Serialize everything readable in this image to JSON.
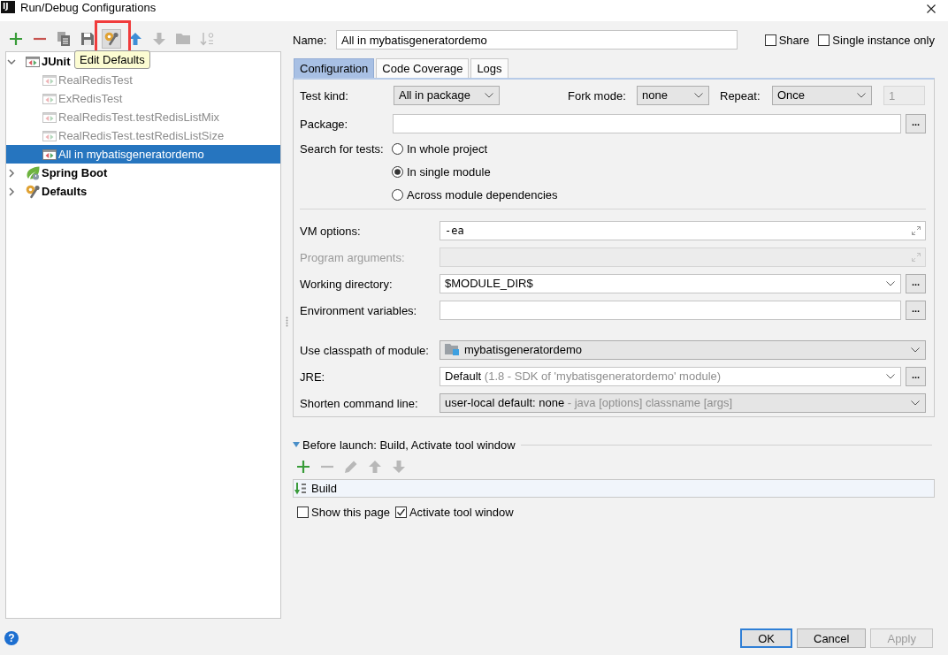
{
  "window": {
    "logo": "IJ",
    "title": "Run/Debug Configurations"
  },
  "toolbar": [
    {
      "kind": "add",
      "disabled": false,
      "hovered": false,
      "highlighted": false
    },
    {
      "kind": "remove",
      "disabled": false,
      "hovered": false,
      "highlighted": false
    },
    {
      "kind": "copy",
      "disabled": false,
      "hovered": false,
      "highlighted": false
    },
    {
      "kind": "save",
      "disabled": false,
      "hovered": false,
      "highlighted": false
    },
    {
      "kind": "edit-defaults",
      "disabled": false,
      "hovered": true,
      "highlighted": true
    },
    {
      "kind": "move-up",
      "disabled": false,
      "hovered": false,
      "highlighted": false
    },
    {
      "kind": "move-down",
      "disabled": true,
      "hovered": false,
      "highlighted": false
    },
    {
      "kind": "folder",
      "disabled": true,
      "hovered": false,
      "highlighted": false
    },
    {
      "kind": "sort",
      "disabled": true,
      "hovered": false,
      "highlighted": false
    }
  ],
  "tooltip": {
    "text": "Edit Defaults"
  },
  "tree": [
    {
      "label": "JUnit",
      "kind": "junit",
      "expanded": true,
      "selected": false,
      "children": [
        {
          "label": "RealRedisTest",
          "kind": "junit",
          "temporary": true,
          "selected": false
        },
        {
          "label": "ExRedisTest",
          "kind": "junit",
          "temporary": true,
          "selected": false
        },
        {
          "label": "RealRedisTest.testRedisListMix",
          "kind": "junit",
          "temporary": true,
          "selected": false
        },
        {
          "label": "RealRedisTest.testRedisListSize",
          "kind": "junit",
          "temporary": true,
          "selected": false
        },
        {
          "label": "All in mybatisgeneratordemo",
          "kind": "junit",
          "temporary": false,
          "selected": true
        }
      ]
    },
    {
      "label": "Spring Boot",
      "kind": "spring-boot",
      "expanded": false,
      "selected": false
    },
    {
      "label": "Defaults",
      "kind": "defaults",
      "expanded": false,
      "selected": false
    }
  ],
  "name": {
    "label": "Name:",
    "value": "All in mybatisgeneratordemo"
  },
  "options": [
    {
      "label": "Share",
      "checked": false
    },
    {
      "label": "Single instance only",
      "checked": false
    }
  ],
  "tabs": [
    {
      "label": "Configuration",
      "selected": true
    },
    {
      "label": "Code Coverage",
      "selected": false
    },
    {
      "label": "Logs",
      "selected": false
    }
  ],
  "configuration": {
    "test_kind": {
      "label": "Test kind:",
      "value": "All in package"
    },
    "fork_mode": {
      "label": "Fork mode:",
      "value": "none"
    },
    "repeat": {
      "label": "Repeat:",
      "value": "Once",
      "count": "1",
      "count_disabled": true
    },
    "package": {
      "label": "Package:",
      "browse": "..."
    },
    "search_for_tests": {
      "label": "Search for tests:",
      "options": [
        {
          "label": "In whole project",
          "selected": false
        },
        {
          "label": "In single module",
          "selected": true
        },
        {
          "label": "Across module dependencies",
          "selected": false
        }
      ]
    },
    "fields": [
      {
        "kind": "text",
        "label": "VM options:",
        "value": "-ea",
        "disabled": false,
        "expandable": true
      },
      {
        "kind": "text",
        "label": "Program arguments:",
        "disabled": true,
        "expandable": true
      },
      {
        "kind": "combo",
        "label": "Working directory:",
        "value": "$MODULE_DIR$",
        "editable": true,
        "browse": "..."
      },
      {
        "kind": "text",
        "label": "Environment variables:",
        "disabled": false,
        "expandable": false,
        "browse": "..."
      },
      {
        "kind": "module",
        "label": "Use classpath of module:",
        "value": "mybatisgeneratordemo",
        "editable": false,
        "separated": true
      },
      {
        "kind": "combo",
        "label": "JRE:",
        "value": "Default",
        "hint": "(1.8 - SDK of 'mybatisgeneratordemo' module)",
        "editable": true,
        "browse": "..."
      },
      {
        "kind": "combo",
        "label": "Shorten command line:",
        "value": "user-local default: none",
        "hint": "- java [options] classname [args]",
        "editable": false
      }
    ]
  },
  "before_launch": {
    "title": "Before launch: Build, Activate tool window",
    "expanded": true,
    "toolbar": [
      {
        "kind": "add",
        "disabled": false
      },
      {
        "kind": "remove",
        "disabled": true
      },
      {
        "kind": "edit",
        "disabled": true
      },
      {
        "kind": "move-up",
        "disabled": true
      },
      {
        "kind": "move-down",
        "disabled": true
      }
    ],
    "tasks": [
      {
        "label": "Build"
      }
    ],
    "options": [
      {
        "label": "Show this page",
        "checked": false
      },
      {
        "label": "Activate tool window",
        "checked": true
      }
    ]
  },
  "footer": {
    "help": "?",
    "buttons": [
      {
        "label": "OK",
        "default": true,
        "disabled": false
      },
      {
        "label": "Cancel",
        "default": false,
        "disabled": false
      },
      {
        "label": "Apply",
        "default": false,
        "disabled": true
      }
    ]
  }
}
